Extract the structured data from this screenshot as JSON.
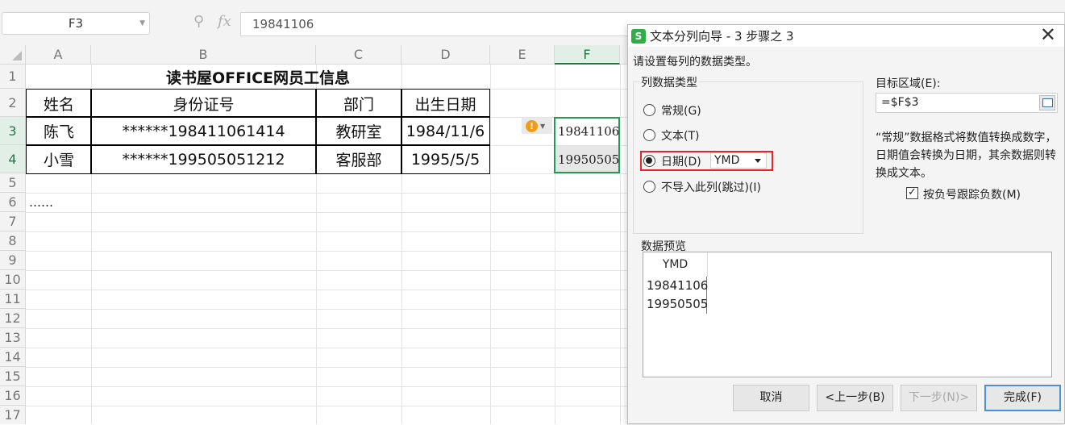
{
  "formula_bar": {
    "name_box": "F3",
    "zoom_icon": "zoom-icon",
    "fx_label": "fx",
    "formula_value": "19841106"
  },
  "columns": [
    "A",
    "B",
    "C",
    "D",
    "E",
    "F"
  ],
  "rows": [
    "1",
    "2",
    "3",
    "4",
    "5",
    "6",
    "7",
    "8",
    "9",
    "10",
    "11",
    "12",
    "13",
    "14",
    "15",
    "16",
    "17"
  ],
  "sheet": {
    "title": "读书屋OFFICE网员工信息",
    "headers": [
      "姓名",
      "身份证号",
      "部门",
      "出生日期"
    ],
    "records": [
      [
        "陈飞",
        "******198411061414",
        "教研室",
        "1984/11/6"
      ],
      [
        "小雪",
        "******199505051212",
        "客服部",
        "1995/5/5"
      ]
    ],
    "ellipsis": "……",
    "column_f": [
      "19841106",
      "19950505"
    ]
  },
  "dialog": {
    "title": "文本分列向导 - 3 步骤之 3",
    "logo_letter": "S",
    "instruction": "请设置每列的数据类型。",
    "group_label": "列数据类型",
    "options": [
      "常规(G)",
      "文本(T)",
      "日期(D)",
      "不导入此列(跳过)(I)"
    ],
    "selected_option": "日期(D)",
    "date_format": "YMD",
    "dest_label": "目标区域(E):",
    "dest_value": "=$F$3",
    "note": "“常规”数据格式将数值转换成数字，日期值会转换为日期，其余数据则转换成文本。",
    "negative_label": "按负号跟踪负数(M)",
    "negative_checked": true,
    "preview_label": "数据预览",
    "preview_header": "YMD",
    "preview_rows": [
      "19841106",
      "19950505"
    ],
    "buttons": {
      "cancel": "取消",
      "back": "<上一步(B)",
      "next": "下一步(N)>",
      "finish": "完成(F)"
    }
  },
  "colors": {
    "accent_green": "#1e7b46",
    "selection_green": "#1f9d55",
    "highlight_red": "#e8242a",
    "warning_orange": "#f29c11",
    "focus_blue": "#4a8fdc"
  }
}
